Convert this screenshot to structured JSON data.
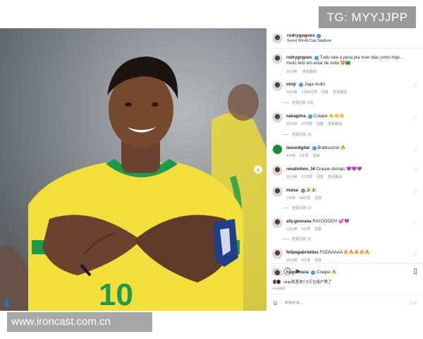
{
  "tg_badge": "TG: MYYJJPP",
  "watermark": "www.ironcast.com.cn",
  "post": {
    "username": "rodrygogoes",
    "location": "Seoul World Cup Stadium",
    "caption": "Tudo vale a pena pra viver dias como hoje... muito feliz em estar de volta 💝🇧🇷",
    "caption_time": "10分钟",
    "caption_translate": "查看翻译",
    "likes_text": "vinijr和其他7.5万位用户赞了",
    "date": "10分钟前",
    "add_comment_placeholder": "添加评论...",
    "post_label": "发布"
  },
  "comments": [
    {
      "user": "vinijr",
      "text": "Joga muito",
      "time": "10分钟",
      "likes": "1,894次赞",
      "reply": "回复",
      "translate": "查看翻译",
      "replies": "查看回复 (39)"
    },
    {
      "user": "nakagima",
      "text": "Craque 👏👏👏",
      "time": "10分钟",
      "likes": "67次赞",
      "reply": "回复",
      "translate": "查看翻译",
      "replies": "查看回复 (3)"
    },
    {
      "user": "lancedigital",
      "text": "Brabissimo! 🔥",
      "time": "4分钟",
      "likes": "4次赞",
      "reply": "回复",
      "translate": "",
      "replies": ""
    },
    {
      "user": "renatinhoo_34",
      "text": "Craque demais 💜💜💜",
      "time": "10分钟",
      "likes": "22次赞",
      "reply": "回复",
      "translate": "查看翻译",
      "replies": ""
    },
    {
      "user": "maisa",
      "text": "🎉🎉",
      "time": "7分钟",
      "likes": "44次赞",
      "reply": "回复",
      "translate": "",
      "replies": "查看回复 (1)"
    },
    {
      "user": "ally.geovana",
      "text": "RAYOOOO!!! 💕💜",
      "time": "10分钟",
      "likes": "5次赞",
      "reply": "回复",
      "translate": "",
      "replies": "查看回复 (1)"
    },
    {
      "user": "felipegabrieldss",
      "text": "FODAAAAA 🔥🔥🔥🔥🔥",
      "time": "10分钟",
      "likes": "4次赞",
      "reply": "回复",
      "translate": "",
      "replies": ""
    },
    {
      "user": "hugosouza",
      "text": "Craque 🔥",
      "time": "",
      "likes": "",
      "reply": "",
      "translate": "",
      "replies": ""
    }
  ],
  "icons": {
    "heart": "heart-icon",
    "comment": "comment-icon",
    "share": "share-icon",
    "bookmark": "bookmark-icon",
    "emoji": "emoji-icon",
    "verified": "verified-icon"
  },
  "colors": {
    "jersey_yellow": "#f2df3c",
    "jersey_green": "#1d9a4c",
    "verified_blue": "#3897f0",
    "link_blue": "#b2dffc"
  }
}
